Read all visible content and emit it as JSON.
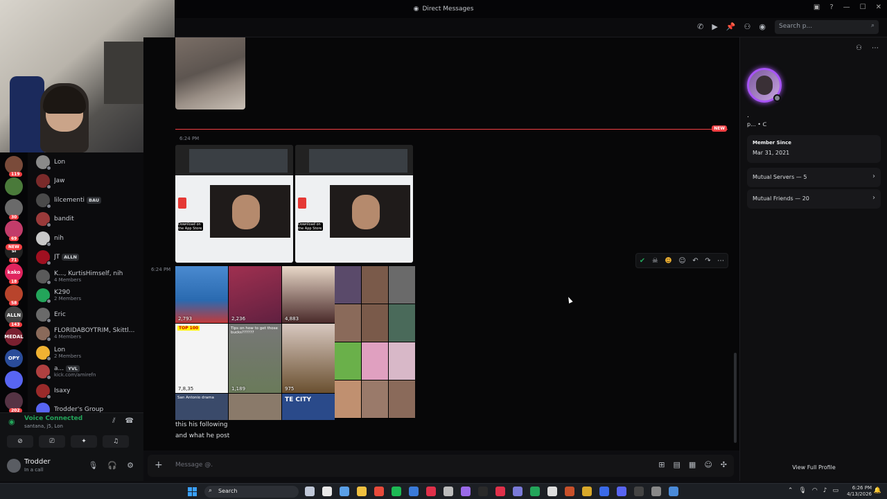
{
  "window": {
    "title": "Direct Messages",
    "controls": [
      "—",
      "☐",
      "✕"
    ]
  },
  "header": {
    "search_placeholder": "Search p...",
    "icons": [
      "phone-icon",
      "video-icon",
      "pin-icon",
      "add-friend-icon",
      "profile-toggle-icon",
      "search-icon"
    ]
  },
  "servers": [
    {
      "badge": "119",
      "color": "#7a4b3a"
    },
    {
      "badge": "",
      "color": "#4a7a3a"
    },
    {
      "badge": "30",
      "color": "#6a6a6a"
    },
    {
      "badge": "69",
      "color": "#c23c6a"
    },
    {
      "badge": "71",
      "color": "#222",
      "label": "sl"
    },
    {
      "badge": "18",
      "color": "#e0245e",
      "label": "kako"
    },
    {
      "badge": "58",
      "color": "#b8442c"
    },
    {
      "badge": "143",
      "color": "#444",
      "label": "ALLN"
    },
    {
      "badge": "",
      "color": "#7a2030",
      "label": "MEDAL"
    },
    {
      "badge": "",
      "color": "#2a4c9a",
      "label": "OPY"
    },
    {
      "badge": "",
      "color": "#5865f2"
    },
    {
      "badge": "202",
      "color": "#553344"
    }
  ],
  "servers_new_label": "NEW",
  "dm_list": [
    {
      "name": "Lon",
      "sub": "",
      "tag": "",
      "color": "#8a8a8a"
    },
    {
      "name": "Jaw",
      "sub": "",
      "tag": "",
      "color": "#7a2a2a"
    },
    {
      "name": "lilcementi",
      "sub": "",
      "tag": "BAU",
      "color": "#4a4a4a"
    },
    {
      "name": "bandit",
      "sub": "",
      "tag": "",
      "color": "#9a3a3a"
    },
    {
      "name": "nih",
      "sub": "",
      "tag": "",
      "color": "#c8c8c8"
    },
    {
      "name": "JT",
      "sub": "",
      "tag": "ALLN",
      "color": "#a01020"
    },
    {
      "name": "K..., KurtisHimself, nih",
      "sub": "4 Members",
      "tag": "",
      "color": "#5a5a5a"
    },
    {
      "name": "K290",
      "sub": "2 Members",
      "tag": "",
      "color": "#23a55a"
    },
    {
      "name": "Eric",
      "sub": "",
      "tag": "",
      "color": "#6a6a6a"
    },
    {
      "name": "FLORIDABOYTRIM, Skittl...",
      "sub": "4 Members",
      "tag": "",
      "color": "#8a6a5a"
    },
    {
      "name": "Lon",
      "sub": "2 Members",
      "tag": "",
      "color": "#f0b232"
    },
    {
      "name": "a...",
      "sub": "kick.com/amirefn",
      "tag": "YVL",
      "color": "#b04040"
    },
    {
      "name": "Isaxy",
      "sub": "",
      "tag": "",
      "color": "#9a2a2a"
    },
    {
      "name": "Trodder's Group",
      "sub": "",
      "tag": "",
      "color": "#5865f2"
    }
  ],
  "voice": {
    "title": "Voice Connected",
    "sub": "santana, j5, Lon"
  },
  "user": {
    "name": "Trodder",
    "status": "In a call"
  },
  "chat": {
    "divider_label": "NEW",
    "timestamp_1": "6:24 PM",
    "timestamp_2": "6:24 PM",
    "tile_counts": [
      "2,793",
      "2,236",
      "4,883",
      "7,8,35",
      "1,189",
      "975"
    ],
    "tile_texts": [
      "TOP 100",
      "Tips on how to get those bucks??????",
      "San Antonio drama",
      "TE CITY"
    ],
    "message_line_1": "this his following",
    "message_line_2": "and what he post",
    "screenshot_badge": "Download on the App Store"
  },
  "composer": {
    "placeholder": "Message @."
  },
  "profile": {
    "display": ".",
    "handle": "p... • ᑕ",
    "member_since_label": "Member Since",
    "member_since_date": "Mar 31, 2021",
    "mutual_servers": "Mutual Servers — 5",
    "mutual_friends": "Mutual Friends — 20",
    "view_full": "View Full Profile"
  },
  "taskbar": {
    "search_label": "Search",
    "time": "6:26 PM",
    "date": "4/13/2026"
  },
  "colors": {
    "accent_red": "#f23f43",
    "online_green": "#23a55a",
    "profile_ring": "#a855f7"
  }
}
